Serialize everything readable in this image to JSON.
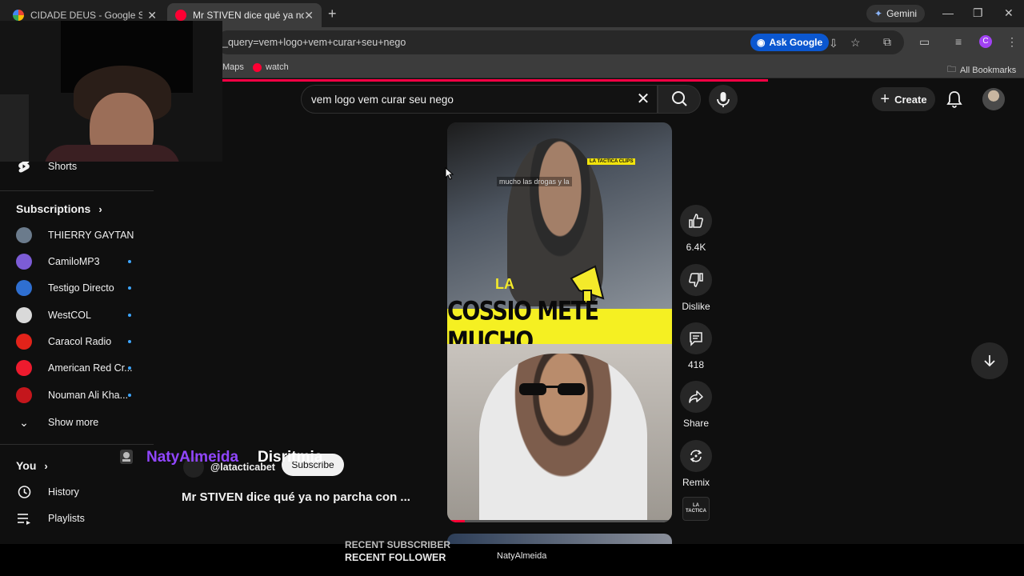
{
  "browser": {
    "tabs": [
      {
        "title": "CIDADE DEUS - Google Search",
        "close": "✕"
      },
      {
        "title": "Mr STIVEN dice qué ya no parcha",
        "close": "✕"
      }
    ],
    "new_tab": "+",
    "gemini_label": "Gemini",
    "window_controls": {
      "minimize": "—",
      "restore": "❐",
      "close": "✕"
    },
    "url": "_query=vem+logo+vem+curar+seu+nego",
    "ask_google_label": "Ask Google",
    "profile_initial": "C",
    "bookmarks": [
      {
        "label": "Maps"
      },
      {
        "label": "watch"
      }
    ],
    "all_bookmarks": "All Bookmarks"
  },
  "youtube": {
    "search": {
      "value": "vem logo vem curar seu nego",
      "clear": "✕"
    },
    "create_label": "Create",
    "sidebar": {
      "shorts_label": "Shorts",
      "subscriptions_heading": "Subscriptions",
      "subscriptions": [
        {
          "name": "THIERRY GAYTAN",
          "color": "#6b7b8c",
          "new": false
        },
        {
          "name": "CamiloMP3",
          "color": "#7c5cd6",
          "new": true
        },
        {
          "name": "Testigo Directo",
          "color": "#2f6fd1",
          "new": true
        },
        {
          "name": "WestCOL",
          "color": "#d9d9d9",
          "new": true
        },
        {
          "name": "Caracol Radio",
          "color": "#e2231a",
          "new": true
        },
        {
          "name": "American Red Cr...",
          "color": "#ed1b2e",
          "new": true
        },
        {
          "name": "Nouman Ali Kha...",
          "color": "#c4161c",
          "new": true
        }
      ],
      "show_more": "Show more",
      "you_heading": "You",
      "you_items": [
        {
          "label": "History"
        },
        {
          "label": "Playlists"
        }
      ]
    },
    "short": {
      "overlay_caption": "mucho las drogas y la",
      "tag": "LA TACTICA CLIPS",
      "la_text": "LA",
      "banner": "COSSIO METE MUCHO",
      "channel_handle": "@latacticabet",
      "subscribe_label": "Subscribe",
      "title": "Mr STIVEN dice qué ya no parcha con ...",
      "progress": 0.08
    },
    "actions": {
      "likes": "6.4K",
      "dislike_label": "Dislike",
      "comments": "418",
      "share_label": "Share",
      "remix_label": "Remix",
      "channel_logo_text": "LA TACTICA"
    }
  },
  "stream_overlay": {
    "alert_name": "NatyAlmeida",
    "alert_message": "Disritmia",
    "recent_subscriber": "RECENT SUBSCRIBER",
    "recent_follower": "RECENT FOLLOWER",
    "follower_name": "NatyAlmeida"
  },
  "colors": {
    "youtube_red": "#ff0033",
    "accent_blue": "#3ea6ff",
    "alert_purple": "#9146ff",
    "banner_yellow": "#f5f022"
  }
}
